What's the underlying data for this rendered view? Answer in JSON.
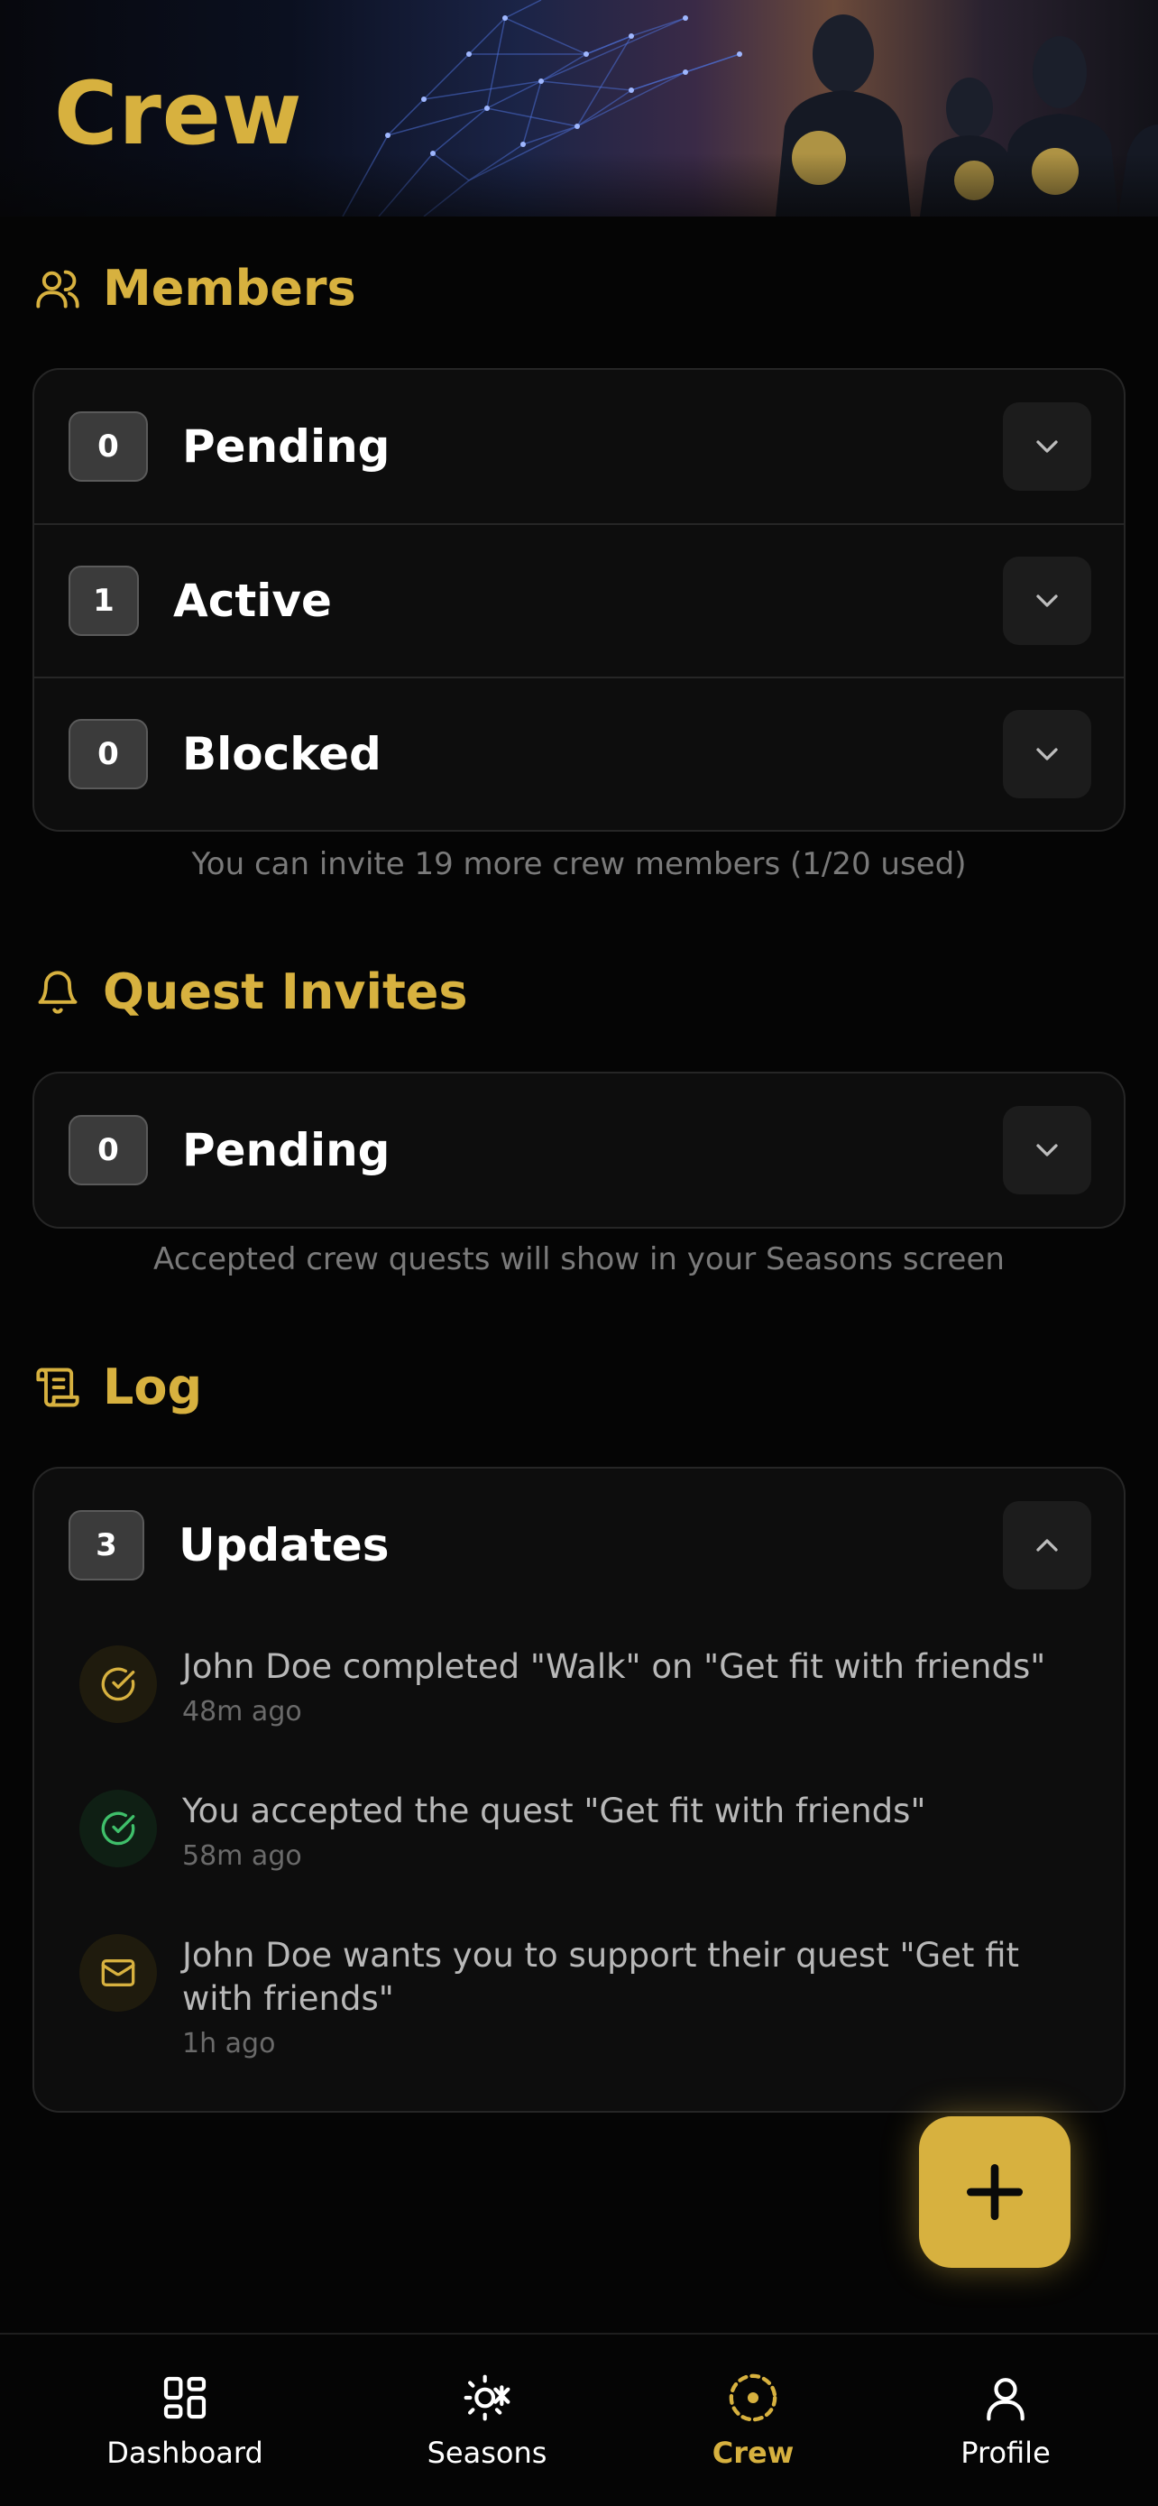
{
  "header": {
    "title": "Crew"
  },
  "members": {
    "title": "Members",
    "rows": [
      {
        "count": "0",
        "label": "Pending"
      },
      {
        "count": "1",
        "label": "Active"
      },
      {
        "count": "0",
        "label": "Blocked"
      }
    ],
    "hint": "You can invite 19 more crew members (1/20 used)"
  },
  "quest_invites": {
    "title": "Quest Invites",
    "rows": [
      {
        "count": "0",
        "label": "Pending"
      }
    ],
    "hint": "Accepted crew quests will show in your Seasons screen"
  },
  "log": {
    "title": "Log",
    "header": {
      "count": "3",
      "label": "Updates"
    },
    "items": [
      {
        "text": "John Doe completed \"Walk\" on \"Get fit with friends\"",
        "time": "48m ago",
        "icon": "check-circle-icon",
        "color": "#d7b13f"
      },
      {
        "text": "You accepted the quest \"Get fit with friends\"",
        "time": "58m ago",
        "icon": "check-circle-icon",
        "color": "#3fbf6a"
      },
      {
        "text": "John Doe wants you to support their quest \"Get fit with friends\"",
        "time": "1h ago",
        "icon": "mail-icon",
        "color": "#d7b13f"
      }
    ]
  },
  "nav": {
    "items": [
      {
        "label": "Dashboard",
        "icon": "dashboard-icon"
      },
      {
        "label": "Seasons",
        "icon": "seasons-icon"
      },
      {
        "label": "Crew",
        "icon": "crew-icon",
        "active": true
      },
      {
        "label": "Profile",
        "icon": "profile-icon"
      }
    ]
  },
  "colors": {
    "accent": "#d7b13f",
    "background": "#050505",
    "success": "#3fbf6a"
  }
}
